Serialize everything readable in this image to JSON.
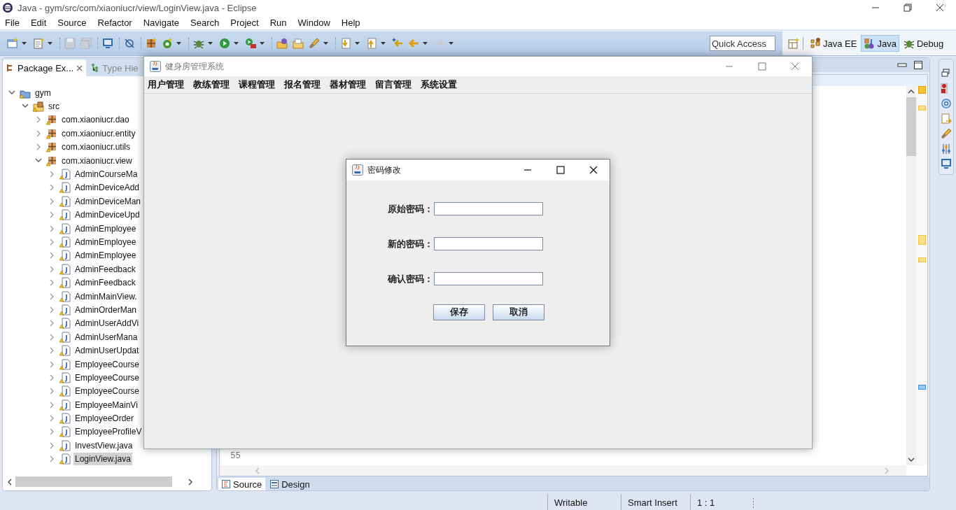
{
  "ide": {
    "title": "Java - gym/src/com/xiaoniucr/view/LoginView.java - Eclipse",
    "menu": [
      "File",
      "Edit",
      "Source",
      "Refactor",
      "Navigate",
      "Search",
      "Project",
      "Run",
      "Window",
      "Help"
    ],
    "quick_access": {
      "placeholder": "Quick Access"
    },
    "perspectives": [
      {
        "label": "Java EE",
        "selected": false
      },
      {
        "label": "Java",
        "selected": true
      },
      {
        "label": "Debug",
        "selected": false
      }
    ],
    "package_explorer": {
      "tabs": [
        {
          "label": "Package Ex...",
          "selected": true
        },
        {
          "label": "Type Hie",
          "selected": false
        }
      ],
      "tree": [
        {
          "kind": "project",
          "label": "gym",
          "expanded": true,
          "selected": false,
          "children": [
            {
              "kind": "source",
              "label": "src",
              "expanded": true,
              "selected": false,
              "children": [
                {
                  "kind": "package",
                  "label": "com.xiaoniucr.dao",
                  "expanded": false,
                  "selected": false
                },
                {
                  "kind": "package",
                  "label": "com.xiaoniucr.entity",
                  "expanded": false,
                  "selected": false
                },
                {
                  "kind": "package",
                  "label": "com.xiaoniucr.utils",
                  "expanded": false,
                  "selected": false
                },
                {
                  "kind": "package",
                  "label": "com.xiaoniucr.view",
                  "expanded": true,
                  "selected": false,
                  "children": [
                    {
                      "kind": "file",
                      "label": "AdminCourseMa",
                      "expanded": false,
                      "selected": false
                    },
                    {
                      "kind": "file",
                      "label": "AdminDeviceAdd",
                      "expanded": false,
                      "selected": false
                    },
                    {
                      "kind": "file",
                      "label": "AdminDeviceMan",
                      "expanded": false,
                      "selected": false
                    },
                    {
                      "kind": "file",
                      "label": "AdminDeviceUpd",
                      "expanded": false,
                      "selected": false
                    },
                    {
                      "kind": "file",
                      "label": "AdminEmployee",
                      "expanded": false,
                      "selected": false
                    },
                    {
                      "kind": "file",
                      "label": "AdminEmployee",
                      "expanded": false,
                      "selected": false
                    },
                    {
                      "kind": "file",
                      "label": "AdminEmployee",
                      "expanded": false,
                      "selected": false
                    },
                    {
                      "kind": "file",
                      "label": "AdminFeedback",
                      "expanded": false,
                      "selected": false
                    },
                    {
                      "kind": "file",
                      "label": "AdminFeedback",
                      "expanded": false,
                      "selected": false
                    },
                    {
                      "kind": "file",
                      "label": "AdminMainView.",
                      "expanded": false,
                      "selected": false
                    },
                    {
                      "kind": "file",
                      "label": "AdminOrderMan",
                      "expanded": false,
                      "selected": false
                    },
                    {
                      "kind": "file",
                      "label": "AdminUserAddVi",
                      "expanded": false,
                      "selected": false
                    },
                    {
                      "kind": "file",
                      "label": "AdminUserMana",
                      "expanded": false,
                      "selected": false
                    },
                    {
                      "kind": "file",
                      "label": "AdminUserUpdat",
                      "expanded": false,
                      "selected": false
                    },
                    {
                      "kind": "file",
                      "label": "EmployeeCourse",
                      "expanded": false,
                      "selected": false
                    },
                    {
                      "kind": "file",
                      "label": "EmployeeCourse",
                      "expanded": false,
                      "selected": false
                    },
                    {
                      "kind": "file",
                      "label": "EmployeeCourse",
                      "expanded": false,
                      "selected": false
                    },
                    {
                      "kind": "file",
                      "label": "EmployeeMainVi",
                      "expanded": false,
                      "selected": false
                    },
                    {
                      "kind": "file",
                      "label": "EmployeeOrder",
                      "expanded": false,
                      "selected": false
                    },
                    {
                      "kind": "file",
                      "label": "EmployeeProfileV",
                      "expanded": false,
                      "selected": false
                    },
                    {
                      "kind": "file",
                      "label": "InvestView.java",
                      "expanded": false,
                      "selected": false
                    },
                    {
                      "kind": "file",
                      "label": "LoginView.java",
                      "expanded": false,
                      "selected": true
                    }
                  ]
                }
              ]
            }
          ]
        }
      ]
    },
    "editor": {
      "line_number": "55",
      "bottom_tabs": [
        {
          "label": "Source",
          "selected": true
        },
        {
          "label": "Design",
          "selected": false
        }
      ]
    },
    "status_bar": [
      "Writable",
      "Smart Insert",
      "1 : 1"
    ]
  },
  "app_window": {
    "title": "健身房管理系统",
    "menu": [
      "用户管理",
      "教练管理",
      "课程管理",
      "报名管理",
      "器材管理",
      "留言管理",
      "系统设置"
    ]
  },
  "dialog": {
    "title": "密码修改",
    "fields": [
      {
        "label": "原始密码："
      },
      {
        "label": "新的密码："
      },
      {
        "label": "确认密码："
      }
    ],
    "buttons": [
      "保存",
      "取消"
    ]
  }
}
